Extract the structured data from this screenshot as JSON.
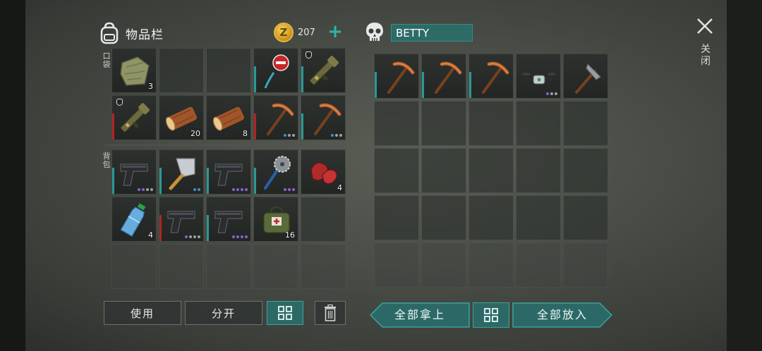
{
  "inventory": {
    "title": "物品栏",
    "coins": "207",
    "coin_symbol": "Z",
    "pocket_label": "口袋",
    "backpack_label": "背包",
    "pocket_slots": [
      {
        "icon": "cloth-bundle-icon",
        "count": "3"
      },
      {
        "icon": "",
        "count": ""
      },
      {
        "icon": "",
        "count": ""
      },
      {
        "icon": "stop-sign-icon",
        "count": "",
        "bar": "#2a9a96"
      },
      {
        "icon": "rpg-launcher-icon",
        "count": "",
        "bar": "#2a9a96",
        "shield": true
      },
      {
        "icon": "rpg-launcher-icon",
        "count": "",
        "bar": "#b02424",
        "shield": true
      },
      {
        "icon": "wood-log-icon",
        "count": "20"
      },
      {
        "icon": "wood-log-icon",
        "count": "8"
      },
      {
        "icon": "pickaxe-icon",
        "count": "",
        "bar": "#b02424",
        "dots": [
          "#3a8fd0",
          "#9aa0a0",
          "#9aa0a0"
        ]
      },
      {
        "icon": "pickaxe-icon",
        "count": "",
        "bar": "#2a9a96",
        "dots": [
          "#3a8fd0",
          "#9aa0a0",
          "#9aa0a0"
        ]
      }
    ],
    "backpack_slots": [
      {
        "icon": "pistol-icon",
        "count": "",
        "bar": "#2a9a96",
        "dots": [
          "#8a60d0",
          "#8a60d0",
          "#9aa0a0",
          "#9aa0a0"
        ]
      },
      {
        "icon": "cleaver-icon",
        "count": "",
        "bar": "#2a9a96",
        "dots": [
          "#3a8fd0",
          "#3a8fd0"
        ]
      },
      {
        "icon": "pistol-icon",
        "count": "",
        "bar": "#2a9a96",
        "dots": [
          "#8a60d0",
          "#8a60d0",
          "#8a60d0",
          "#8a60d0"
        ]
      },
      {
        "icon": "saw-mace-icon",
        "count": "",
        "bar": "#2a9a96",
        "dots": [
          "#8a60d0",
          "#8a60d0",
          "#8a60d0"
        ]
      },
      {
        "icon": "raw-meat-icon",
        "count": "4"
      },
      {
        "icon": "water-bottle-icon",
        "count": "4"
      },
      {
        "icon": "pistol-icon",
        "count": "",
        "bar": "#b02424",
        "dots": [
          "#8a60d0",
          "#9aa0a0",
          "#9aa0a0",
          "#9aa0a0"
        ]
      },
      {
        "icon": "pistol-icon",
        "count": "",
        "bar": "#2a9a96",
        "dots": [
          "#8a60d0",
          "#8a60d0",
          "#8a60d0",
          "#8a60d0"
        ]
      },
      {
        "icon": "first-aid-bag-icon",
        "count": "16"
      },
      {
        "icon": "",
        "count": ""
      },
      {
        "icon": "",
        "count": ""
      },
      {
        "icon": "",
        "count": ""
      },
      {
        "icon": "",
        "count": ""
      },
      {
        "icon": "",
        "count": ""
      },
      {
        "icon": "",
        "count": ""
      }
    ],
    "buttons": {
      "use": "使用",
      "split": "分开"
    }
  },
  "container": {
    "name": "BETTY",
    "slots": [
      {
        "icon": "pickaxe-icon",
        "bar": "#2a9a96"
      },
      {
        "icon": "pickaxe-icon",
        "bar": "#2a9a96"
      },
      {
        "icon": "pickaxe-icon",
        "bar": "#2a9a96"
      },
      {
        "icon": "drone-icon",
        "dots": [
          "#8a60d0",
          "#9aa0a0",
          "#9aa0a0"
        ]
      },
      {
        "icon": "hammer-pick-icon"
      }
    ],
    "buttons": {
      "take_all": "全部拿上",
      "put_all": "全部放入"
    }
  },
  "close_label": "关闭",
  "colors": {
    "accent": "#2c6966",
    "teal_bar": "#2a9a96",
    "red_bar": "#b02424"
  }
}
